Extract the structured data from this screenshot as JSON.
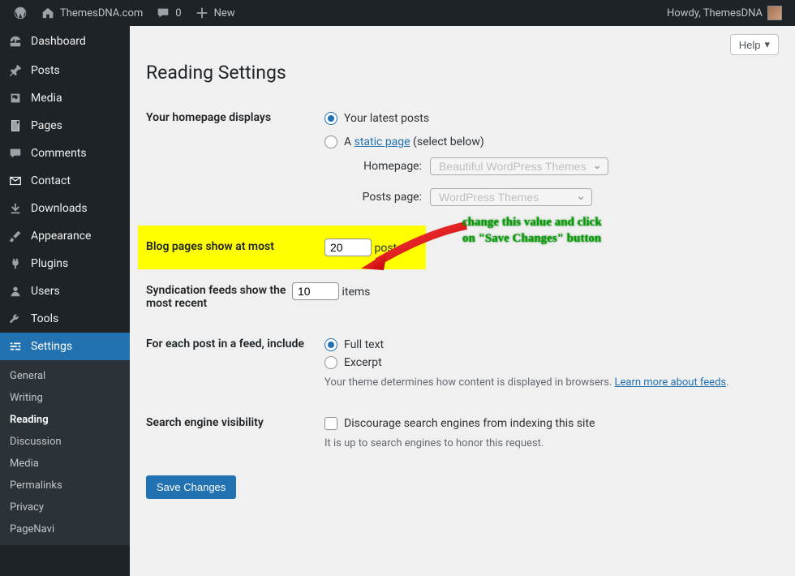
{
  "adminbar": {
    "site_name": "ThemesDNA.com",
    "comments_count": "0",
    "new_label": "New",
    "greeting": "Howdy, ThemesDNA"
  },
  "sidebar": {
    "items": [
      {
        "id": "dashboard",
        "label": "Dashboard",
        "icon": "dashboard"
      },
      {
        "id": "posts",
        "label": "Posts",
        "icon": "pin"
      },
      {
        "id": "media",
        "label": "Media",
        "icon": "media"
      },
      {
        "id": "pages",
        "label": "Pages",
        "icon": "pages"
      },
      {
        "id": "comments",
        "label": "Comments",
        "icon": "comment"
      },
      {
        "id": "contact",
        "label": "Contact",
        "icon": "email"
      },
      {
        "id": "downloads",
        "label": "Downloads",
        "icon": "download"
      },
      {
        "id": "appearance",
        "label": "Appearance",
        "icon": "brush"
      },
      {
        "id": "plugins",
        "label": "Plugins",
        "icon": "plug"
      },
      {
        "id": "users",
        "label": "Users",
        "icon": "user"
      },
      {
        "id": "tools",
        "label": "Tools",
        "icon": "wrench"
      },
      {
        "id": "settings",
        "label": "Settings",
        "icon": "sliders",
        "current": true
      }
    ],
    "submenu": [
      {
        "label": "General"
      },
      {
        "label": "Writing"
      },
      {
        "label": "Reading",
        "current": true
      },
      {
        "label": "Discussion"
      },
      {
        "label": "Media"
      },
      {
        "label": "Permalinks"
      },
      {
        "label": "Privacy"
      },
      {
        "label": "PageNavi"
      }
    ]
  },
  "page": {
    "help_label": "Help",
    "title": "Reading Settings",
    "homepage_displays": {
      "label": "Your homepage displays",
      "opt_latest": "Your latest posts",
      "opt_static_prefix": "A ",
      "opt_static_link": "static page",
      "opt_static_suffix": " (select below)",
      "homepage_label": "Homepage:",
      "homepage_value": "Beautiful WordPress Themes",
      "postspage_label": "Posts page:",
      "postspage_value": "WordPress Themes"
    },
    "blog_pages": {
      "label": "Blog pages show at most",
      "value": "20",
      "unit": "posts"
    },
    "syndication": {
      "label": "Syndication feeds show the most recent",
      "value": "10",
      "unit": "items"
    },
    "feed_content": {
      "label": "For each post in a feed, include",
      "opt_full": "Full text",
      "opt_excerpt": "Excerpt",
      "desc_prefix": "Your theme determines how content is displayed in browsers. ",
      "desc_link": "Learn more about feeds",
      "desc_suffix": "."
    },
    "search_vis": {
      "label": "Search engine visibility",
      "checkbox_label": "Discourage search engines from indexing this site",
      "desc": "It is up to search engines to honor this request."
    },
    "save_label": "Save Changes"
  },
  "annotation": {
    "line1": "change this value and click",
    "line2": "on \"Save Changes\" button"
  }
}
